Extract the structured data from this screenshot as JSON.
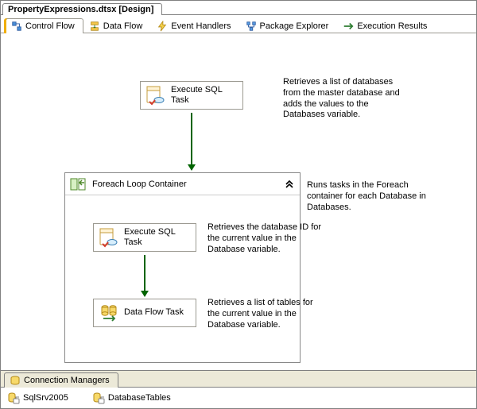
{
  "title_tab": "PropertyExpressions.dtsx [Design]",
  "tabs": [
    {
      "label": "Control Flow",
      "icon": "control-flow-icon",
      "active": true
    },
    {
      "label": "Data Flow",
      "icon": "data-flow-icon"
    },
    {
      "label": "Event Handlers",
      "icon": "event-handlers-icon"
    },
    {
      "label": "Package Explorer",
      "icon": "package-explorer-icon"
    },
    {
      "label": "Execution Results",
      "icon": "execution-results-icon"
    }
  ],
  "tasks": {
    "exec_sql_top": "Execute SQL Task",
    "foreach_header": "Foreach Loop Container",
    "exec_sql_inner": "Execute SQL Task",
    "data_flow": "Data Flow Task"
  },
  "annotations": {
    "a1": "Retrieves a list of databases from the master database and adds the values to the Databases variable.",
    "a2": "Runs tasks in the Foreach container for each Database in Databases.",
    "a3": "Retrieves the database ID for the current value in the Database variable.",
    "a4": "Retrieves a list of tables for the current value in the Database variable."
  },
  "connection_managers": {
    "section_label": "Connection Managers",
    "items": [
      {
        "label": "SqlSrv2005",
        "icon": "db-conn-icon"
      },
      {
        "label": "DatabaseTables",
        "icon": "db-conn-icon"
      }
    ]
  },
  "colors": {
    "success_arrow": "#006400",
    "active_tab_accent": "#f0ae00",
    "border": "#9c9a91",
    "bg_chrome": "#ece9d8"
  }
}
